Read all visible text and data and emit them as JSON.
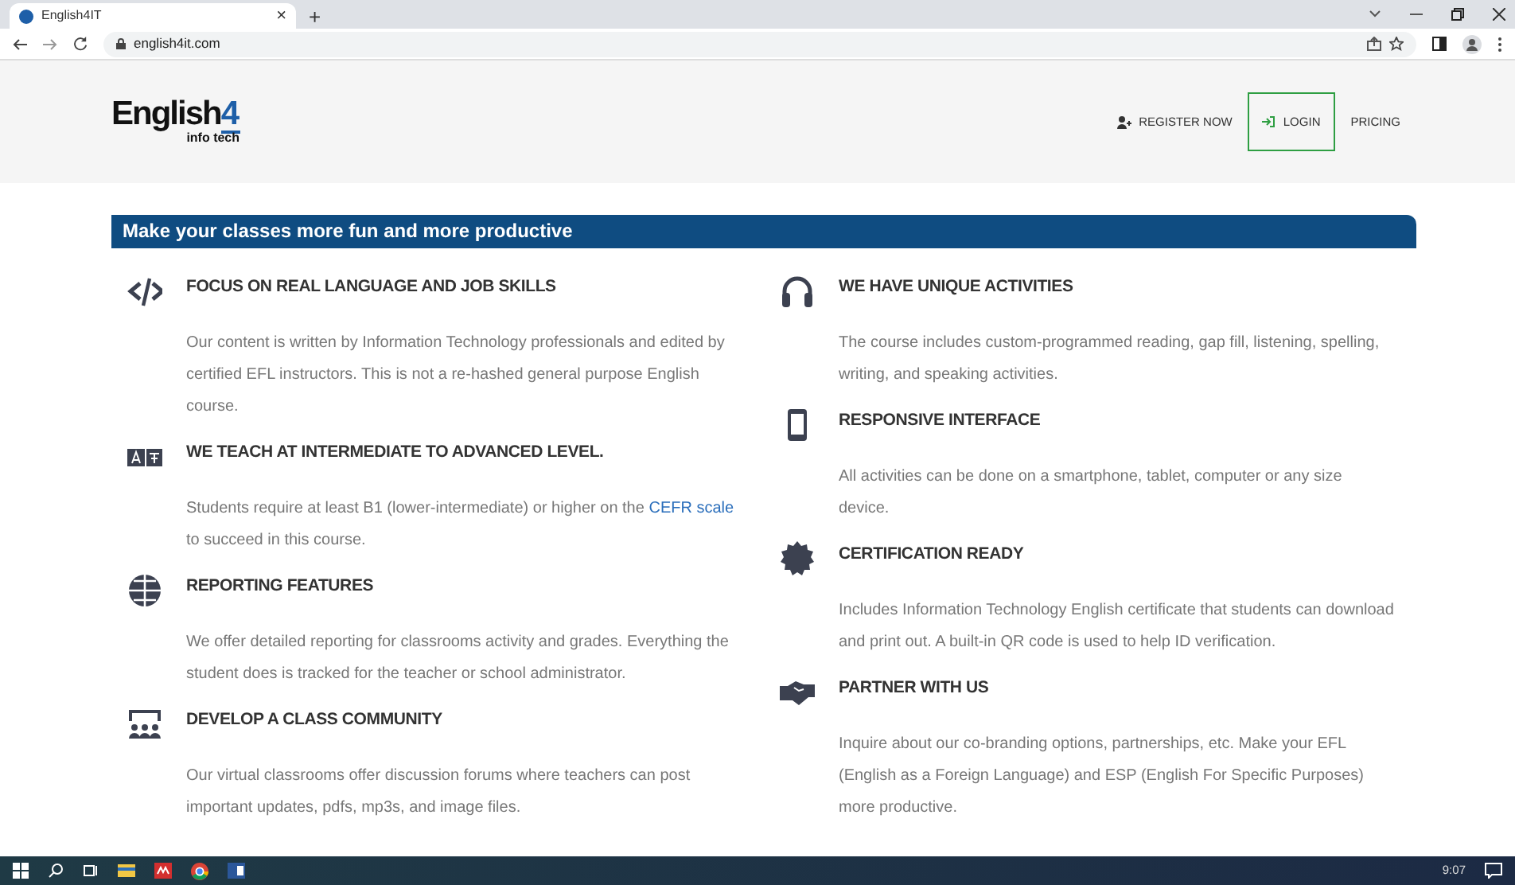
{
  "browser": {
    "tab_title": "English4IT",
    "tab_close": "×",
    "new_tab": "+",
    "url": "english4it.com"
  },
  "header": {
    "logo": {
      "word": "English",
      "digit": "4",
      "tagline": "info tech"
    },
    "nav": [
      {
        "label": "REGISTER NOW",
        "kind": "register"
      },
      {
        "label": "LOGIN",
        "kind": "login"
      },
      {
        "label": "PRICING",
        "kind": "plain"
      }
    ]
  },
  "banner": "Make your classes more fun and more productive",
  "columns": [
    [
      {
        "title": "FOCUS ON REAL LANGUAGE AND JOB SKILLS",
        "body": [
          {
            "kind": "text",
            "text": "Our content is written by Information Technology professionals and edited by certified EFL instructors. This is not a re-hashed general purpose English course."
          }
        ]
      },
      {
        "title": "WE TEACH AT INTERMEDIATE TO ADVANCED LEVEL.",
        "body": [
          {
            "kind": "text",
            "text": "Students require at least B1 (lower-intermediate) or higher on the "
          },
          {
            "kind": "link",
            "text": "CEFR scale"
          },
          {
            "kind": "text",
            "text": " to succeed in this course."
          }
        ]
      },
      {
        "title": "REPORTING FEATURES",
        "body": [
          {
            "kind": "text",
            "text": "We offer detailed reporting for classrooms activity and grades. Everything the student does is tracked for the teacher or school administrator."
          }
        ]
      },
      {
        "title": "DEVELOP A CLASS COMMUNITY",
        "body": [
          {
            "kind": "text",
            "text": "Our virtual classrooms offer discussion forums where teachers can post important updates, pdfs, mp3s, and image files."
          }
        ]
      }
    ],
    [
      {
        "title": "WE HAVE UNIQUE ACTIVITIES",
        "body": [
          {
            "kind": "text",
            "text": "The course includes custom-programmed reading, gap fill, listening, spelling, writing, and speaking activities."
          }
        ]
      },
      {
        "title": "RESPONSIVE INTERFACE",
        "body": [
          {
            "kind": "text",
            "text": "All activities can be done on a smartphone, tablet, computer or any size device."
          }
        ]
      },
      {
        "title": "CERTIFICATION READY",
        "body": [
          {
            "kind": "text",
            "text": "Includes Information Technology English certificate that students can download and print out. A built-in QR code is used to help ID verification."
          }
        ]
      },
      {
        "title": "PARTNER WITH US",
        "body": [
          {
            "kind": "text",
            "text": "Inquire about our co-branding options, partnerships, etc. Make your EFL (English as a Foreign Language) and ESP (English For Specific Purposes) more productive."
          }
        ]
      }
    ]
  ],
  "taskbar": {
    "clock": "9:07"
  }
}
